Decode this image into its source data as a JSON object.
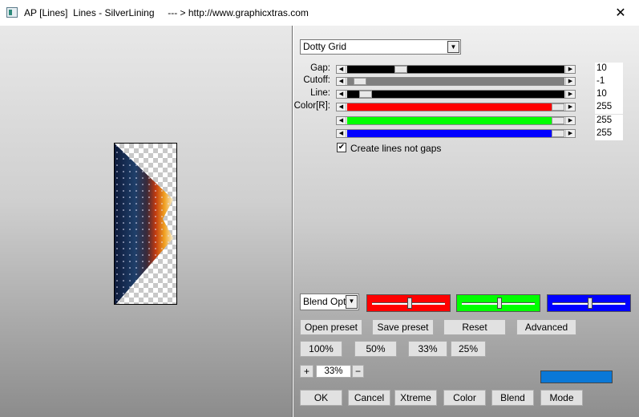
{
  "titlebar": {
    "title": "AP [Lines]  Lines - SilverLining     --- > http://www.graphicxtras.com",
    "close_label": "✕"
  },
  "controls": {
    "style_select": "Dotty Grid",
    "sliders": [
      {
        "label": "Gap:",
        "value": "10",
        "fill": "#000000",
        "level": 0.23
      },
      {
        "label": "Cutoff:",
        "value": "-1",
        "fill": "#808080",
        "level": 0.03
      },
      {
        "label": "Line:",
        "value": "10",
        "fill": "#000000",
        "level": 0.06
      },
      {
        "label": "Color[R]:",
        "value": "255",
        "fill": "#ff0000",
        "level": 1.0
      },
      {
        "label": "",
        "value": "255",
        "fill": "#00ff00",
        "level": 1.0
      },
      {
        "label": "",
        "value": "255",
        "fill": "#0000ff",
        "level": 1.0
      }
    ],
    "checkbox_label": "Create lines not gaps",
    "checkbox_checked": "✔",
    "blend_select": "Blend Optio",
    "color_sliders": [
      {
        "color": "#ff0000",
        "level": 0.5
      },
      {
        "color": "#00ff00",
        "level": 0.5
      },
      {
        "color": "#0000ff",
        "level": 0.5
      }
    ],
    "buttons_row1": [
      "Open preset",
      "Save preset",
      "Reset",
      "Advanced"
    ],
    "zoom_buttons": [
      "100%",
      "50%",
      "33%",
      "25%"
    ],
    "zoom_plus": "+",
    "zoom_value": "33%",
    "zoom_minus": "−",
    "swatch_color": "#0a78d7",
    "buttons_bottom": [
      "OK",
      "Cancel",
      "Xtreme",
      "Color",
      "Blend",
      "Mode"
    ]
  }
}
